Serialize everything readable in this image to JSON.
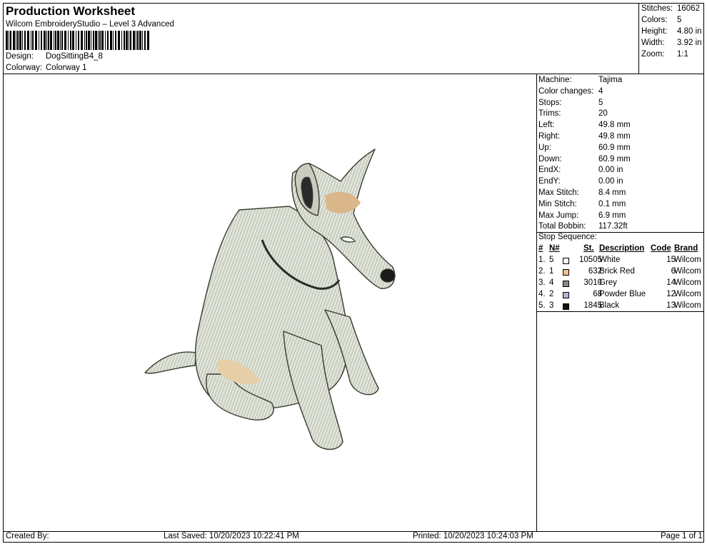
{
  "header": {
    "title": "Production Worksheet",
    "software": "Wilcom EmbroideryStudio – Level 3 Advanced",
    "design_label": "Design:",
    "design_value": "DogSittingB4_8",
    "colorway_label": "Colorway:",
    "colorway_value": "Colorway 1"
  },
  "summary": [
    {
      "label": "Stitches:",
      "value": "16062"
    },
    {
      "label": "Colors:",
      "value": "5"
    },
    {
      "label": "Height:",
      "value": "4.80 in"
    },
    {
      "label": "Width:",
      "value": "3.92 in"
    },
    {
      "label": "Zoom:",
      "value": "1:1"
    }
  ],
  "machine_info": [
    {
      "label": "Machine:",
      "value": "Tajima"
    },
    {
      "label": "Color changes:",
      "value": "4"
    },
    {
      "label": "Stops:",
      "value": "5"
    },
    {
      "label": "Trims:",
      "value": "20"
    },
    {
      "label": "Left:",
      "value": "49.8 mm"
    },
    {
      "label": "Right:",
      "value": "49.8 mm"
    },
    {
      "label": "Up:",
      "value": "60.9 mm"
    },
    {
      "label": "Down:",
      "value": "60.9 mm"
    },
    {
      "label": "EndX:",
      "value": "0.00 in"
    },
    {
      "label": "EndY:",
      "value": "0.00 in"
    },
    {
      "label": "Max Stitch:",
      "value": "8.4 mm"
    },
    {
      "label": "Min Stitch:",
      "value": "0.1 mm"
    },
    {
      "label": "Max Jump:",
      "value": "6.9 mm"
    },
    {
      "label": "Total Bobbin:",
      "value": "117.32ft"
    }
  ],
  "stop_sequence": {
    "title": "Stop Sequence:",
    "columns": {
      "num": "#",
      "n": "N#",
      "st": "St.",
      "desc": "Description",
      "code": "Code",
      "brand": "Brand"
    },
    "rows": [
      {
        "num": "1.",
        "n": "5",
        "color": "#ffffff",
        "st": "10505",
        "desc": "White",
        "code": "15",
        "brand": "Wilcom"
      },
      {
        "num": "2.",
        "n": "1",
        "color": "#f2c08c",
        "st": "632",
        "desc": "Brick Red",
        "code": "6",
        "brand": "Wilcom"
      },
      {
        "num": "3.",
        "n": "4",
        "color": "#8a8a8a",
        "st": "3010",
        "desc": "Grey",
        "code": "14",
        "brand": "Wilcom"
      },
      {
        "num": "4.",
        "n": "2",
        "color": "#b8b0d8",
        "st": "68",
        "desc": "Powder Blue",
        "code": "12",
        "brand": "Wilcom"
      },
      {
        "num": "5.",
        "n": "3",
        "color": "#111111",
        "st": "1845",
        "desc": "Black",
        "code": "13",
        "brand": "Wilcom"
      }
    ]
  },
  "footer": {
    "created_by": "Created By:",
    "last_saved": "Last Saved: 10/20/2023 10:22:41 PM",
    "printed": "Printed: 10/20/2023 10:24:03 PM",
    "page": "Page 1 of 1"
  }
}
